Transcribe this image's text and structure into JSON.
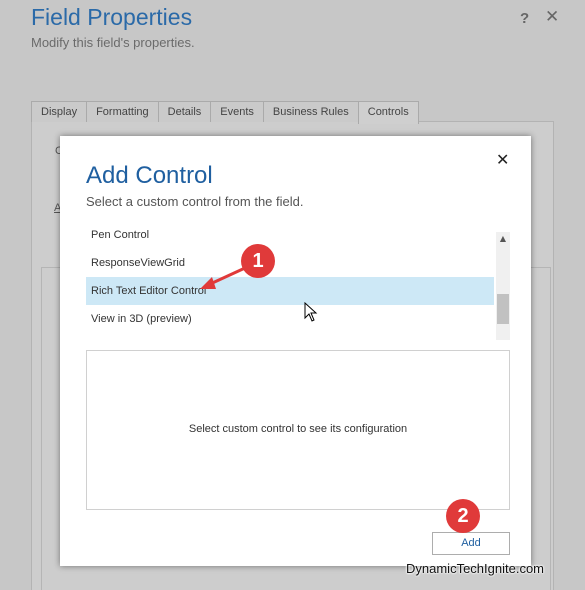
{
  "background_dialog": {
    "title": "Field Properties",
    "subtitle": "Modify this field's properties.",
    "help_label": "?",
    "close_label": "✕",
    "tabs": [
      {
        "label": "Display"
      },
      {
        "label": "Formatting"
      },
      {
        "label": "Details"
      },
      {
        "label": "Events"
      },
      {
        "label": "Business Rules"
      },
      {
        "label": "Controls",
        "active": true
      }
    ],
    "snippet_1": "C",
    "snippet_2": "A"
  },
  "modal": {
    "title": "Add Control",
    "subtitle": "Select a custom control from the field.",
    "close_label": "✕",
    "controls_list": [
      {
        "label": "Pen Control"
      },
      {
        "label": "ResponseViewGrid"
      },
      {
        "label": "Rich Text Editor Control",
        "selected": true
      },
      {
        "label": "View in 3D (preview)"
      }
    ],
    "config_placeholder": "Select custom control to see its configuration",
    "add_label": "Add"
  },
  "annotations": {
    "step_1": "1",
    "step_2": "2",
    "badge_color": "#e03a3a"
  },
  "watermark": "DynamicTechIgnite.com",
  "colors": {
    "accent": "#1f5fa0",
    "selection": "#cde8f6"
  }
}
